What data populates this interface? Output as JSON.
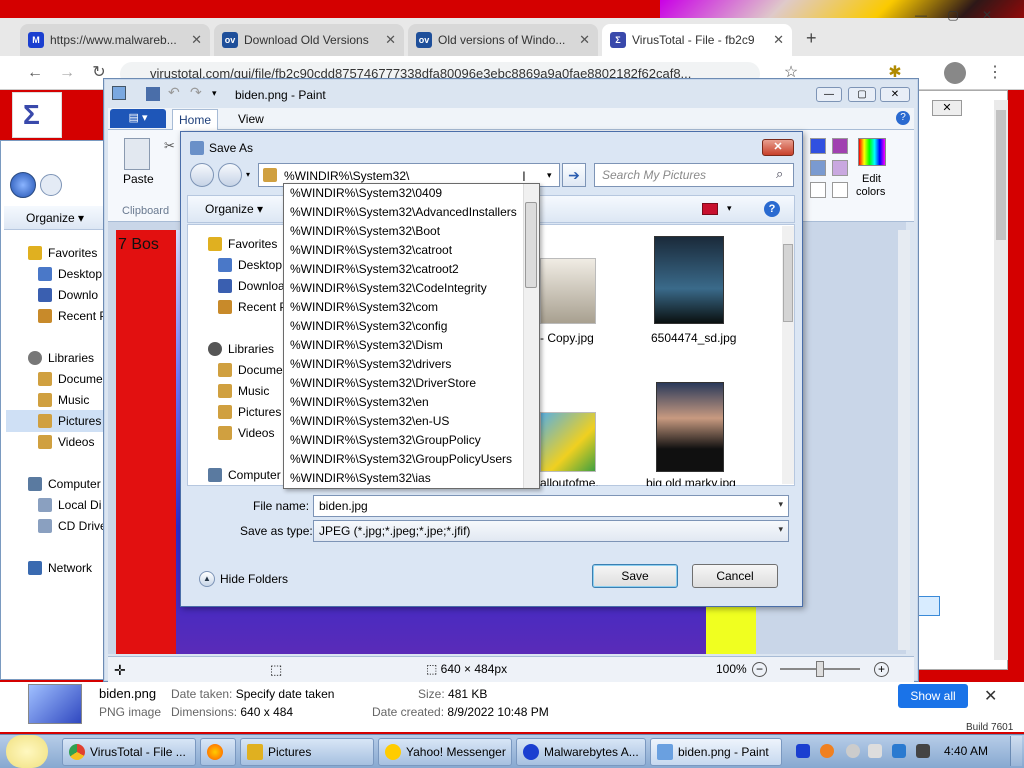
{
  "chrome": {
    "tabs": [
      {
        "label": "https://www.malwareb...",
        "icon": "malwarebytes-icon",
        "fav": "M",
        "color": "#1b3fd0"
      },
      {
        "label": "Download Old Versions",
        "icon": "oldversion-icon",
        "fav": "ov",
        "color": "#1e4f9a"
      },
      {
        "label": "Old versions of Windo...",
        "icon": "oldversion-icon",
        "fav": "ov",
        "color": "#1e4f9a"
      },
      {
        "label": "VirusTotal - File - fb2c9",
        "icon": "virustotal-icon",
        "fav": "Σ",
        "color": "#3949ab"
      }
    ],
    "url": "virustotal.com/gui/file/fb2c90cdd875746777338dfa80096e3ebc8869a9a0fae8802182f62caf8..."
  },
  "paint": {
    "title": "biden.png - Paint",
    "tabs": {
      "home": "Home",
      "view": "View"
    },
    "ribbon": {
      "paste": "Paste",
      "clipboard": "Clipboard",
      "edit_colors_1": "Edit",
      "edit_colors_2": "colors"
    },
    "status": {
      "dimensions": "640 × 484px",
      "zoom": "100%"
    },
    "canvas_text": "7 Bos"
  },
  "explorer": {
    "organize": "Organize",
    "items": [
      {
        "label": "Favorites",
        "color": "#e0b020"
      },
      {
        "label": "Desktop",
        "color": "#4a78c8"
      },
      {
        "label": "Downlo",
        "color": "#3a5fb0"
      },
      {
        "label": "Recent P",
        "color": "#c88a2a"
      },
      {
        "label": "Libraries",
        "color": "#777"
      },
      {
        "label": "Docume",
        "color": "#d0a040"
      },
      {
        "label": "Music",
        "color": "#d0a040"
      },
      {
        "label": "Pictures",
        "color": "#d0a040"
      },
      {
        "label": "Videos",
        "color": "#d0a040"
      },
      {
        "label": "Computer",
        "color": "#5a7aa0"
      },
      {
        "label": "Local Di",
        "color": "#8aa0c0"
      },
      {
        "label": "CD Drive",
        "color": "#8aa0c0"
      },
      {
        "label": "Network",
        "color": "#3a6ab0"
      }
    ]
  },
  "dialog": {
    "title": "Save As",
    "address": "%WINDIR%\\System32\\",
    "search_placeholder": "Search My Pictures",
    "organize": "Organize",
    "nav": [
      {
        "label": "Favorites",
        "color": "#e0b020"
      },
      {
        "label": "Desktop",
        "color": "#4a78c8"
      },
      {
        "label": "Download",
        "color": "#3a5fb0"
      },
      {
        "label": "Recent P",
        "color": "#c88a2a"
      },
      {
        "label": "Libraries",
        "color": "#666"
      },
      {
        "label": "Docume",
        "color": "#d0a040"
      },
      {
        "label": "Music",
        "color": "#d0a040"
      },
      {
        "label": "Pictures",
        "color": "#d0a040"
      },
      {
        "label": "Videos",
        "color": "#d0a040"
      },
      {
        "label": "Computer",
        "color": "#5a7aa0"
      }
    ],
    "files": [
      {
        "label": "- Copy.jpg"
      },
      {
        "label": "6504474_sd.jpg"
      },
      {
        "label": "alloutofme..."
      },
      {
        "label": "big old marky.jpg"
      }
    ],
    "file_name_label": "File name:",
    "file_name": "biden.jpg",
    "save_type_label": "Save as type:",
    "save_type": "JPEG (*.jpg;*.jpeg;*.jpe;*.jfif)",
    "hide_folders": "Hide Folders",
    "save": "Save",
    "cancel": "Cancel",
    "dropdown": [
      "%WINDIR%\\System32\\0409",
      "%WINDIR%\\System32\\AdvancedInstallers",
      "%WINDIR%\\System32\\Boot",
      "%WINDIR%\\System32\\catroot",
      "%WINDIR%\\System32\\catroot2",
      "%WINDIR%\\System32\\CodeIntegrity",
      "%WINDIR%\\System32\\com",
      "%WINDIR%\\System32\\config",
      "%WINDIR%\\System32\\Dism",
      "%WINDIR%\\System32\\drivers",
      "%WINDIR%\\System32\\DriverStore",
      "%WINDIR%\\System32\\en",
      "%WINDIR%\\System32\\en-US",
      "%WINDIR%\\System32\\GroupPolicy",
      "%WINDIR%\\System32\\GroupPolicyUsers",
      "%WINDIR%\\System32\\ias"
    ]
  },
  "details": {
    "name": "biden.png",
    "type": "PNG image",
    "date_taken_label": "Date taken:",
    "date_taken": "Specify date taken",
    "dimensions_label": "Dimensions:",
    "dimensions": "640 x 484",
    "size_label": "Size:",
    "size": "481 KB",
    "created_label": "Date created:",
    "created": "8/9/2022 10:48 PM"
  },
  "downloads": {
    "show_all": "Show all",
    "build": "Build 7601"
  },
  "taskbar": {
    "items": [
      {
        "label": "VirusTotal - File ...",
        "color": "#e04030"
      },
      {
        "label": "",
        "color": "#ff8a00"
      },
      {
        "label": "Pictures",
        "color": "#e0b020"
      },
      {
        "label": "Yahoo! Messenger",
        "color": "#ffcc00"
      },
      {
        "label": "Malwarebytes A...",
        "color": "#1b3fd0"
      },
      {
        "label": "biden.png - Paint",
        "color": "#6aa0e0"
      }
    ],
    "clock": "4:40 AM"
  }
}
